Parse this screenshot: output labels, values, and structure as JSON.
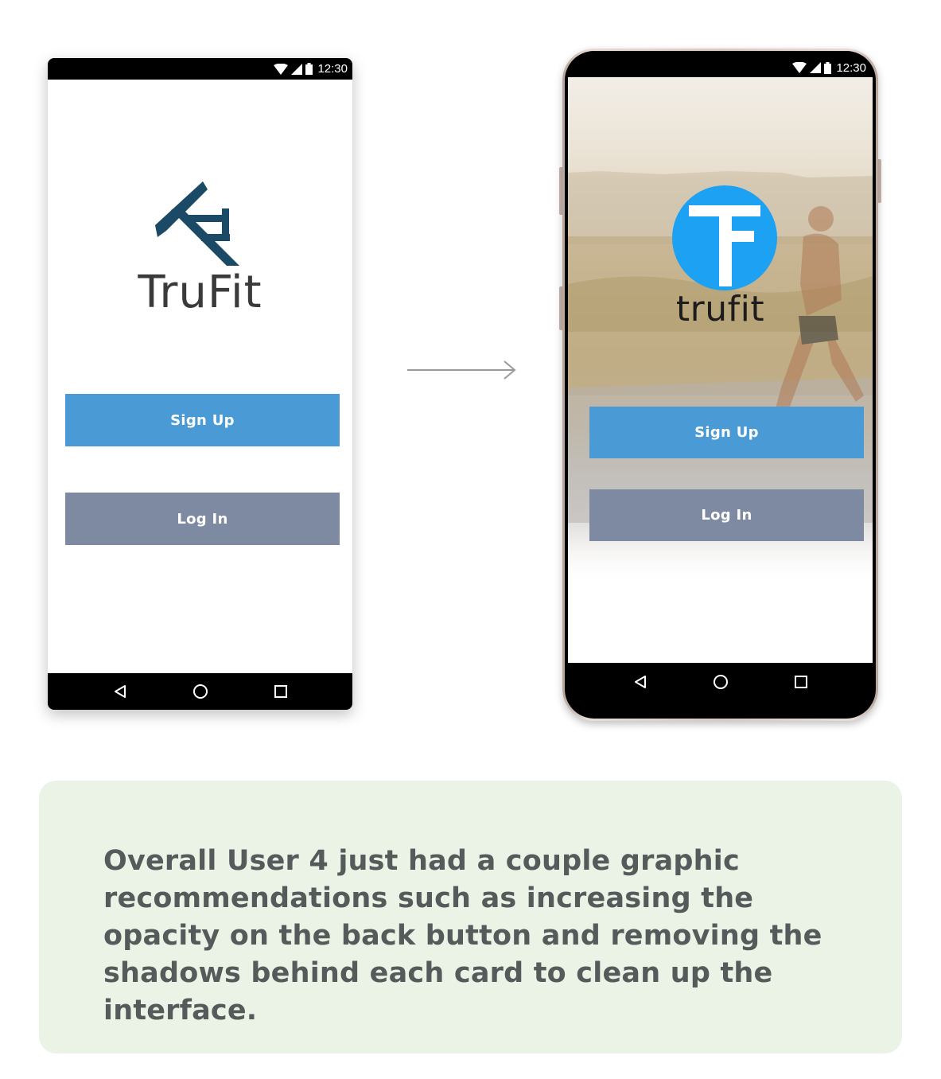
{
  "before_screen": {
    "status_time": "12:30",
    "brand_name": "TruFit",
    "signup_label": "Sign Up",
    "login_label": "Log In",
    "logo_color": "#1b4a66"
  },
  "after_screen": {
    "status_time": "12:30",
    "brand_name": "trufit",
    "signup_label": "Sign Up",
    "login_label": "Log In",
    "logo_color": "#1da1f2"
  },
  "colors": {
    "signup_button": "#4a9bd5",
    "login_button": "#7d8aa1",
    "caption_background": "#eaf3e5",
    "caption_text": "#555a5a"
  },
  "caption": {
    "text": "Overall User 4 just had a couple graphic recommendations such as increasing the opacity on the back button and removing the shadows behind each card to clean up the interface."
  }
}
